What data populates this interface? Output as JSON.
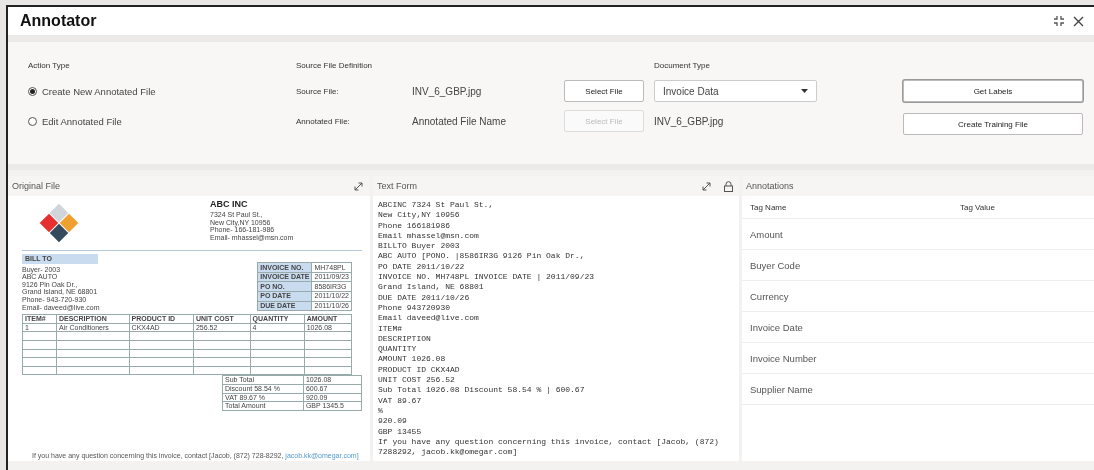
{
  "window": {
    "title": "Annotator"
  },
  "action_type": {
    "label": "Action Type",
    "options": [
      {
        "label": "Create New Annotated File",
        "selected": true
      },
      {
        "label": "Edit Annotated File",
        "selected": false
      }
    ]
  },
  "source_file_definition": {
    "label": "Source File Definition",
    "rows": [
      {
        "label": "Source File:",
        "value": "INV_6_GBP.jpg",
        "button": "Select File",
        "disabled": false
      },
      {
        "label": "Annotated File:",
        "value": "Annotated File Name",
        "button": "Select File",
        "disabled": true
      }
    ]
  },
  "document_type": {
    "label": "Document Type",
    "value": "Invoice Data",
    "file": "INV_6_GBP.jpg"
  },
  "buttons": [
    "Get Labels",
    "Create Training File"
  ],
  "original_file": {
    "title": "Original File",
    "invoice": {
      "company": "ABC INC",
      "address": [
        "7324 St Paul St.,",
        "New City,NY 10956",
        "Phone- 166-181-986",
        "Email- mhassel@msn.com"
      ],
      "bill_to": "BILL TO",
      "buyer": [
        "Buyer- 2003",
        "ABC AUTO",
        "9126 Pin Oak Dr.,",
        "Grand Island, NE 68801",
        "Phone- 943-720-930",
        "Email- daveed@live.com"
      ],
      "info": [
        [
          "INVOICE NO.",
          "MH748PL"
        ],
        [
          "INVOICE DATE",
          "2011/09/23"
        ],
        [
          "PO NO.",
          "8586IR3G"
        ],
        [
          "PO DATE",
          "2011/10/22"
        ],
        [
          "DUE DATE",
          "2011/10/26"
        ]
      ],
      "columns": [
        "ITEM#",
        "DESCRIPTION",
        "PRODUCT ID",
        "UNIT COST",
        "QUANTITY",
        "AMOUNT"
      ],
      "rows": [
        [
          "1",
          "Air Conditioners",
          "CKX4AD",
          "256.52",
          "4",
          "1026.08"
        ],
        [
          "",
          "",
          "",
          "",
          "",
          ""
        ],
        [
          "",
          "",
          "",
          "",
          "",
          ""
        ],
        [
          "",
          "",
          "",
          "",
          "",
          ""
        ],
        [
          "",
          "",
          "",
          "",
          "",
          ""
        ],
        [
          "",
          "",
          "",
          "",
          "",
          ""
        ]
      ],
      "totals": [
        [
          "Sub Total",
          "1026.08"
        ],
        [
          "Discount  58.54  %",
          "600.67"
        ],
        [
          "VAT  89.67    %",
          "920.09"
        ],
        [
          "Total Amount",
          "GBP    1345.5"
        ]
      ],
      "footer": "If you have any question concerning this invoice, contact [Jacob, (872) 728-8292,",
      "footer_link": "jacob.kk@omegar.com]"
    }
  },
  "text_form": {
    "title": "Text Form",
    "lines": [
      "ABCINC 7324 St Paul St.,",
      "New City,NY 10956",
      "Phone 166181986",
      "Email mhassel@msn.com",
      "BILLTO Buyer 2003",
      "ABC AUTO [PONO. |8586IR3G 9126 Pin Oak Dr.,",
      "PO DATE 2011/10/22",
      "INVOICE NO. MH748PL INVOICE DATE | 2011/09/23",
      "Grand Island, NE 68801",
      "DUE DATE 2011/10/26",
      "Phone 943720930",
      "Email daveed@live.com",
      "ITEM#",
      "DESCRIPTION",
      "QUANTITY",
      "AMOUNT 1026.08",
      "PRODUCT ID CKX4AD",
      "UNIT COST 256.52",
      "Sub Total 1026.08 Discount 58.54 % | 600.67",
      "VAT 89.67",
      "%",
      "920.09",
      "GBP 13455",
      "If you have any question concerning this invoice, contact [Jacob, (872)",
      "7288292, jacob.kk@omegar.com]"
    ]
  },
  "annotations": {
    "title": "Annotations",
    "columns": [
      "Tag Name",
      "Tag Value"
    ],
    "rows": [
      {
        "name": "Amount",
        "value": ""
      },
      {
        "name": "Buyer Code",
        "value": ""
      },
      {
        "name": "Currency",
        "value": ""
      },
      {
        "name": "Invoice Date",
        "value": ""
      },
      {
        "name": "Invoice Number",
        "value": ""
      },
      {
        "name": "Supplier Name",
        "value": ""
      }
    ]
  }
}
